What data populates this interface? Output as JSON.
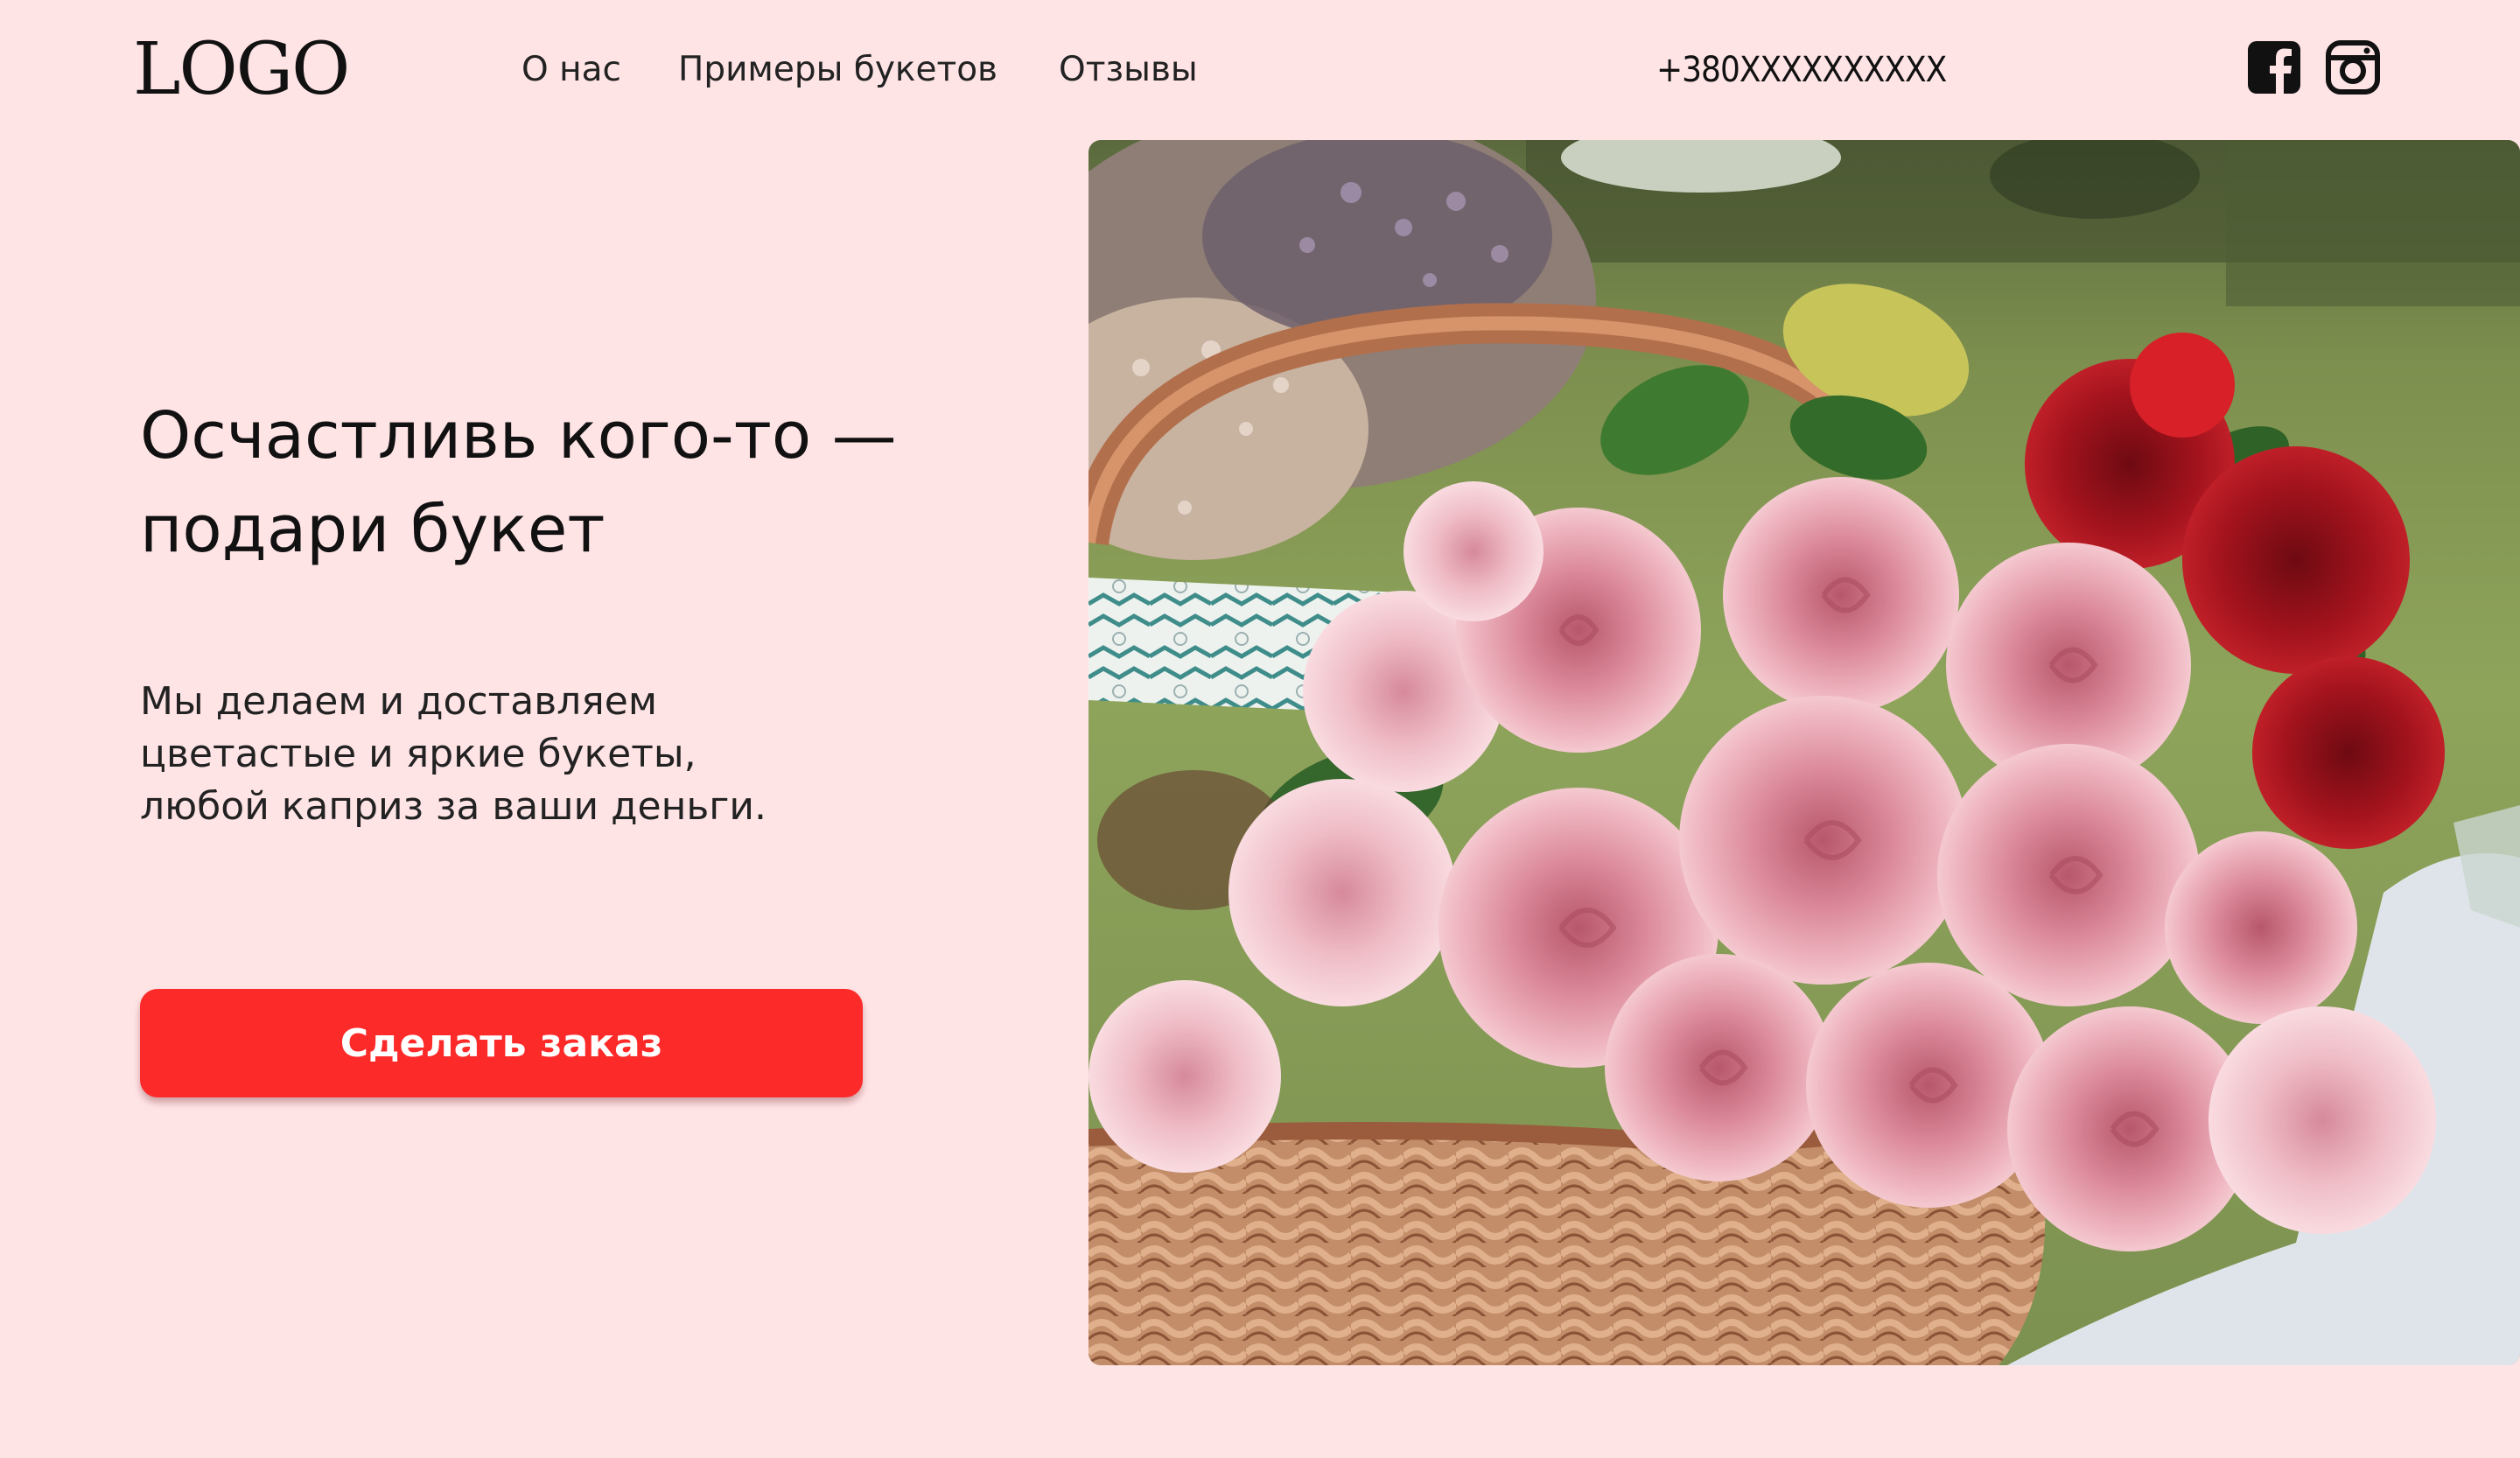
{
  "header": {
    "logo": "LOGO",
    "nav": [
      {
        "label": "О нас"
      },
      {
        "label": "Примеры букетов"
      },
      {
        "label": "Отзывы"
      }
    ],
    "phone": "+380XXXXXXXXXX",
    "social": [
      {
        "icon": "facebook-icon"
      },
      {
        "icon": "instagram-icon"
      }
    ]
  },
  "hero": {
    "title_line1": "Осчастливь кого-то —",
    "title_line2": "подари букет",
    "description_line1": "Мы делаем и доставляем",
    "description_line2": "цветастые и яркие букеты,",
    "description_line3": "любой каприз за ваши деньги.",
    "cta_label": "Сделать заказ",
    "image_subject": "basket of pink and red roses"
  },
  "colors": {
    "background": "#ffe4e6",
    "accent": "#fd2a2a",
    "text": "#111111"
  }
}
